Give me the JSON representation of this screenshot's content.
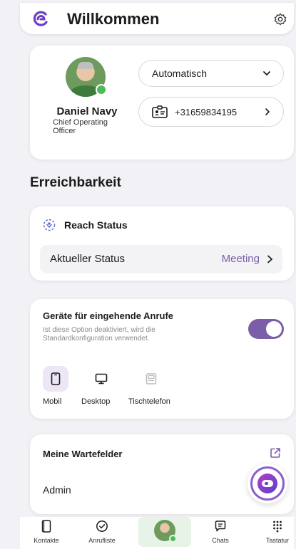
{
  "header": {
    "title": "Willkommen",
    "logo_icon": "brand-logo-icon",
    "settings_icon": "gear-icon"
  },
  "profile": {
    "name": "Daniel Navy",
    "role": "Chief Operating Officer",
    "presence": "online",
    "mode_select": {
      "value": "Automatisch"
    },
    "phone": {
      "number": "+31659834195"
    }
  },
  "section": {
    "title": "Erreichbarkeit"
  },
  "reach": {
    "title": "Reach Status",
    "current_label": "Aktueller Status",
    "current_value": "Meeting"
  },
  "devices": {
    "title": "Geräte für eingehende Anrufe",
    "description": "Ist diese Option deaktiviert, wird die Standardkonfiguration verwendet.",
    "toggle_on": true,
    "items": [
      {
        "label": "Mobil",
        "selected": true
      },
      {
        "label": "Desktop",
        "selected": false
      },
      {
        "label": "Tischtelefon",
        "selected": false,
        "disabled": true
      }
    ]
  },
  "queues": {
    "title": "Meine Wartefelder",
    "items": [
      {
        "label": "Admin"
      }
    ]
  },
  "bottom_nav": {
    "items": [
      {
        "label": "Kontakte"
      },
      {
        "label": "Anrufliste"
      },
      {
        "label": ""
      },
      {
        "label": "Chats"
      },
      {
        "label": "Tastatur"
      }
    ]
  },
  "colors": {
    "accent": "#7b5ea7",
    "status_green": "#4cbb5a",
    "background": "#f2f2f6"
  }
}
